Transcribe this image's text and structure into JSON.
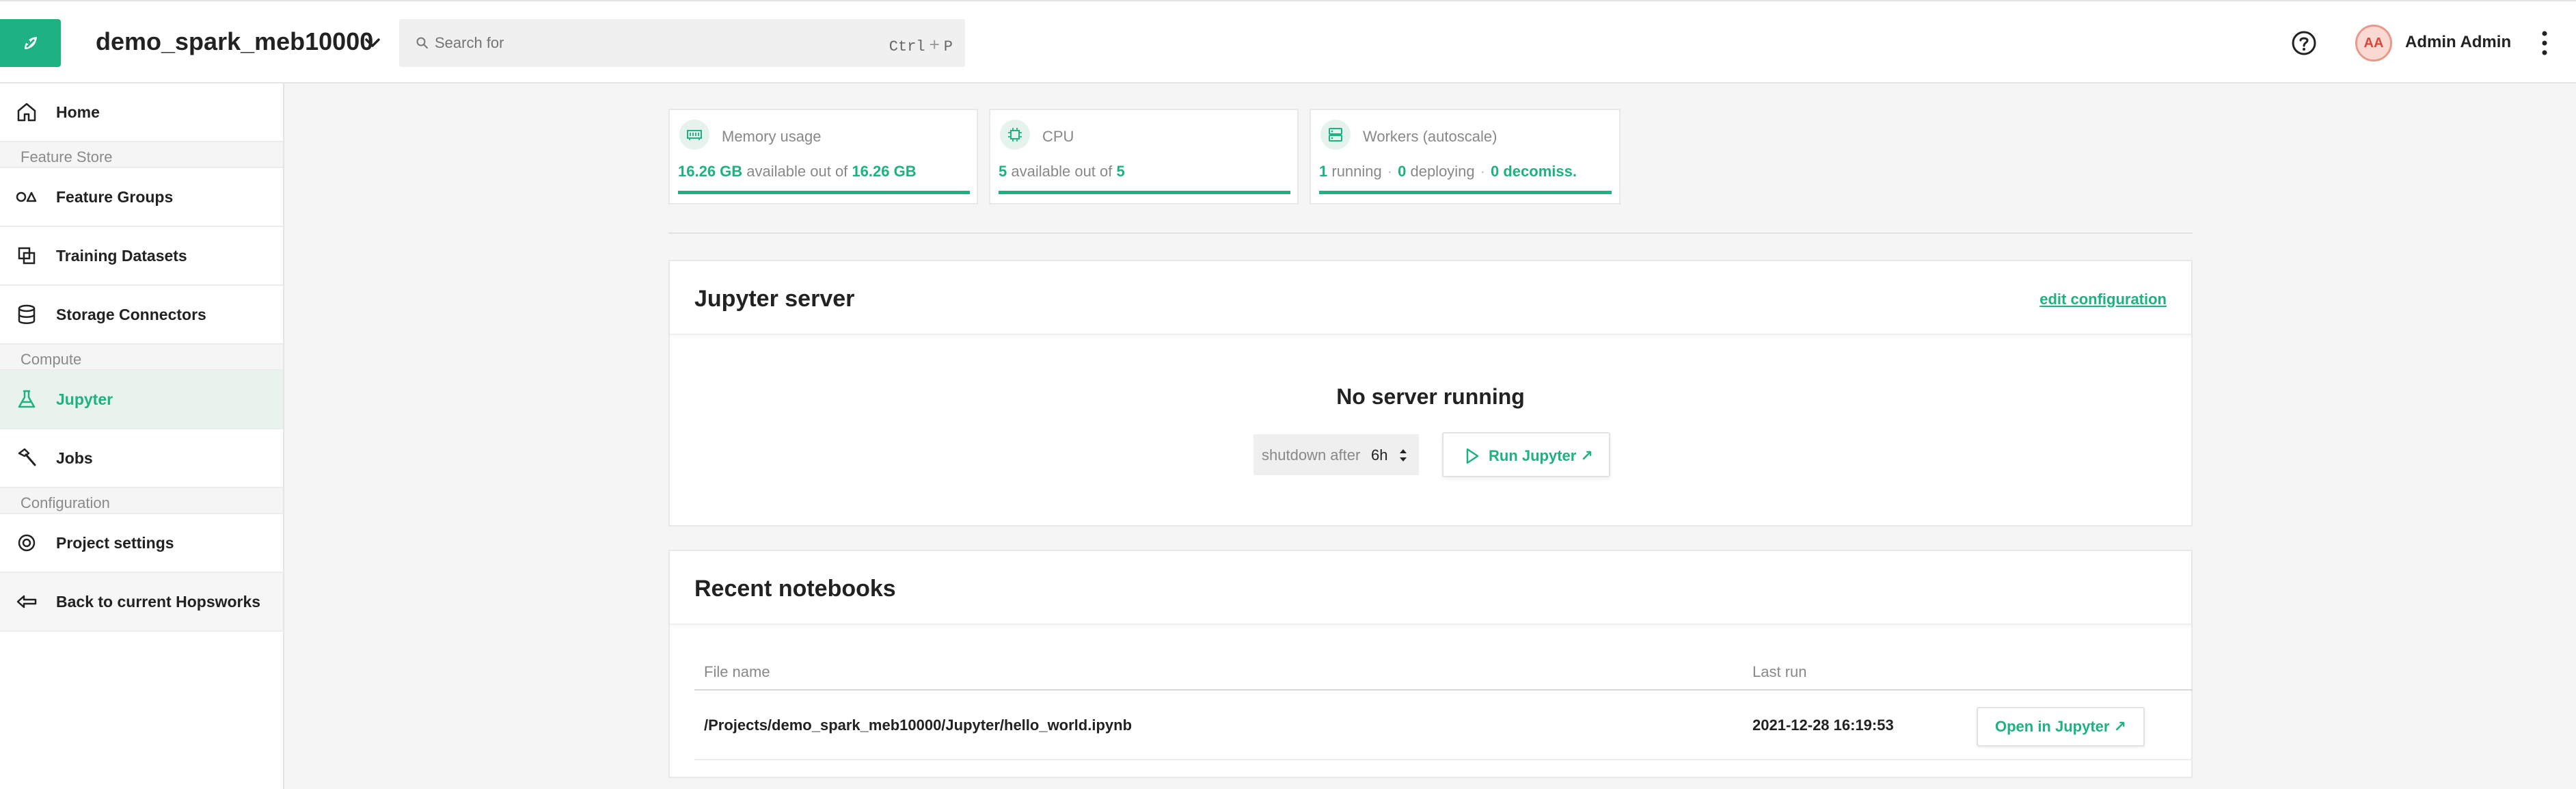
{
  "app": {
    "project_name": "demo_spark_meb10000"
  },
  "search": {
    "placeholder": "Search for",
    "shortcut_key1": "Ctrl",
    "shortcut_plus": "+",
    "shortcut_key2": "P"
  },
  "user": {
    "initials": "AA",
    "name": "Admin Admin"
  },
  "sidebar": {
    "home": "Home",
    "section_feature_store": "Feature Store",
    "feature_groups": "Feature Groups",
    "training_datasets": "Training Datasets",
    "storage_connectors": "Storage Connectors",
    "section_compute": "Compute",
    "jupyter": "Jupyter",
    "jobs": "Jobs",
    "section_configuration": "Configuration",
    "project_settings": "Project settings",
    "back": "Back to current Hopsworks"
  },
  "metrics": {
    "memory": {
      "title": "Memory usage",
      "available": "16.26 GB",
      "available_text": "available out of",
      "total": "16.26 GB",
      "fill_fraction": 1.0
    },
    "cpu": {
      "title": "CPU",
      "available": "5",
      "available_text": "available out of",
      "total": "5",
      "fill_fraction": 1.0
    },
    "workers": {
      "title": "Workers (autoscale)",
      "running_count": "1",
      "running_text": "running",
      "deploying_count": "0",
      "deploying_text": "deploying",
      "decomiss_count": "0",
      "decomiss_text": "decomiss.",
      "separator": "·",
      "fill_fraction": 1.0
    }
  },
  "jupyter_server": {
    "title": "Jupyter server",
    "edit_link": "edit configuration",
    "status": "No server running",
    "shutdown_label": "shutdown after",
    "shutdown_value": "6h",
    "run_button": "Run Jupyter ↗"
  },
  "recent_notebooks": {
    "title": "Recent notebooks",
    "columns": {
      "file_name": "File name",
      "last_run": "Last run"
    },
    "rows": [
      {
        "file_name": "/Projects/demo_spark_meb10000/Jupyter/hello_world.ipynb",
        "last_run": "2021-12-28 16:19:53",
        "action": "Open in Jupyter ↗"
      }
    ]
  },
  "colors": {
    "accent": "#1eb182",
    "avatar_bg": "#fbd9d3",
    "avatar_text": "#d9463a"
  }
}
